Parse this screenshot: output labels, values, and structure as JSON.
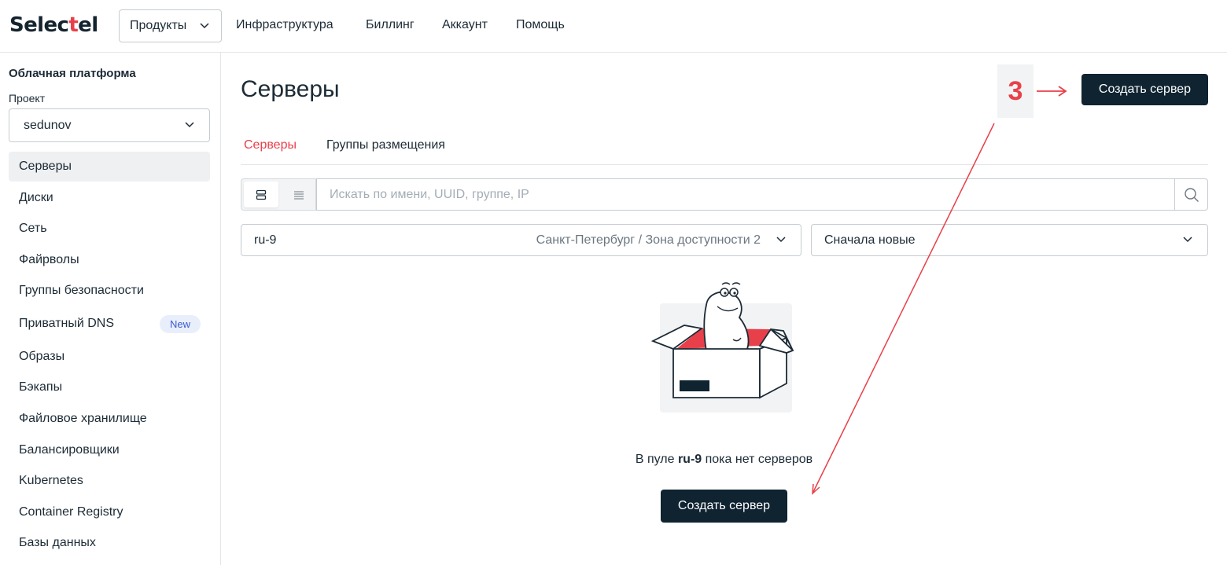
{
  "brand": {
    "name_start": "Selec",
    "name_accent": "t",
    "name_end": "el",
    "accent_color": "#e8404a",
    "dark_color": "#0f2331"
  },
  "topnav": {
    "products_label": "Продукты",
    "links": [
      "Инфраструктура",
      "Биллинг",
      "Аккаунт",
      "Помощь"
    ]
  },
  "sidebar": {
    "title": "Облачная платформа",
    "project_label": "Проект",
    "project_value": "sedunov",
    "items": [
      {
        "label": "Серверы"
      },
      {
        "label": "Диски"
      },
      {
        "label": "Сеть"
      },
      {
        "label": "Файрволы"
      },
      {
        "label": "Группы безопасности"
      },
      {
        "label": "Приватный DNS",
        "badge": "New"
      },
      {
        "label": "Образы"
      },
      {
        "label": "Бэкапы"
      },
      {
        "label": "Файловое хранилище"
      },
      {
        "label": "Балансировщики"
      },
      {
        "label": "Kubernetes"
      },
      {
        "label": "Container Registry"
      },
      {
        "label": "Базы данных"
      }
    ]
  },
  "main": {
    "title": "Серверы",
    "create_button": "Создать сервер",
    "annotation_number": "3",
    "tabs": [
      "Серверы",
      "Группы размещения"
    ],
    "search_placeholder": "Искать по имени, UUID, группе, IP",
    "pool": {
      "value": "ru-9",
      "location": "Санкт-Петербург",
      "separator": "/",
      "zone": "Зона доступности 2"
    },
    "sort": {
      "value": "Сначала новые"
    },
    "empty": {
      "prefix": "В пуле ",
      "pool": "ru-9",
      "suffix": " пока нет серверов",
      "button": "Создать сервер"
    }
  }
}
